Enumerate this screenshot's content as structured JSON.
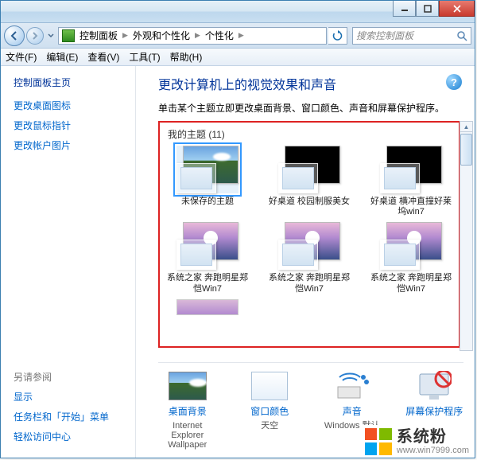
{
  "window": {
    "min_tip": "最小化",
    "max_tip": "最大化",
    "close_tip": "关闭"
  },
  "nav": {
    "crumbs": [
      "控制面板",
      "外观和个性化",
      "个性化"
    ],
    "refresh_tip": "刷新",
    "search_placeholder": "搜索控制面板"
  },
  "menu": {
    "items": [
      "文件(F)",
      "编辑(E)",
      "查看(V)",
      "工具(T)",
      "帮助(H)"
    ]
  },
  "sidebar": {
    "title": "控制面板主页",
    "links": [
      "更改桌面图标",
      "更改鼠标指针",
      "更改帐户图片"
    ],
    "see_also_label": "另请参阅",
    "see_also": [
      "显示",
      "任务栏和「开始」菜单",
      "轻松访问中心"
    ]
  },
  "content": {
    "title": "更改计算机上的视觉效果和声音",
    "subtitle": "单击某个主题立即更改桌面背景、窗口颜色、声音和屏幕保护程序。",
    "section_label": "我的主题 (11)",
    "themes": [
      {
        "label": "未保存的主题",
        "variant": "lake",
        "selected": true
      },
      {
        "label": "好桌道 校园制服美女",
        "variant": "black",
        "selected": false
      },
      {
        "label": "好桌道 横冲直撞好莱坞win7",
        "variant": "black",
        "selected": false
      },
      {
        "label": "系统之家 奔跑明星郑恺Win7",
        "variant": "fly",
        "selected": false
      },
      {
        "label": "系统之家 奔跑明星郑恺Win7",
        "variant": "fly",
        "selected": false
      },
      {
        "label": "系统之家 奔跑明星郑恺Win7",
        "variant": "fly",
        "selected": false
      }
    ],
    "footer": [
      {
        "link": "桌面背景",
        "sub": "Internet Explorer Wallpaper",
        "icon": "wallpaper"
      },
      {
        "link": "窗口颜色",
        "sub": "天空",
        "icon": "color"
      },
      {
        "link": "声音",
        "sub": "Windows 默认",
        "icon": "sound"
      },
      {
        "link": "屏幕保护程序",
        "sub": "",
        "icon": "saver"
      }
    ]
  },
  "watermark": {
    "text": "系统粉",
    "url": "www.win7999.com",
    "colors": [
      "#f25022",
      "#7fba00",
      "#00a4ef",
      "#ffb900"
    ]
  }
}
